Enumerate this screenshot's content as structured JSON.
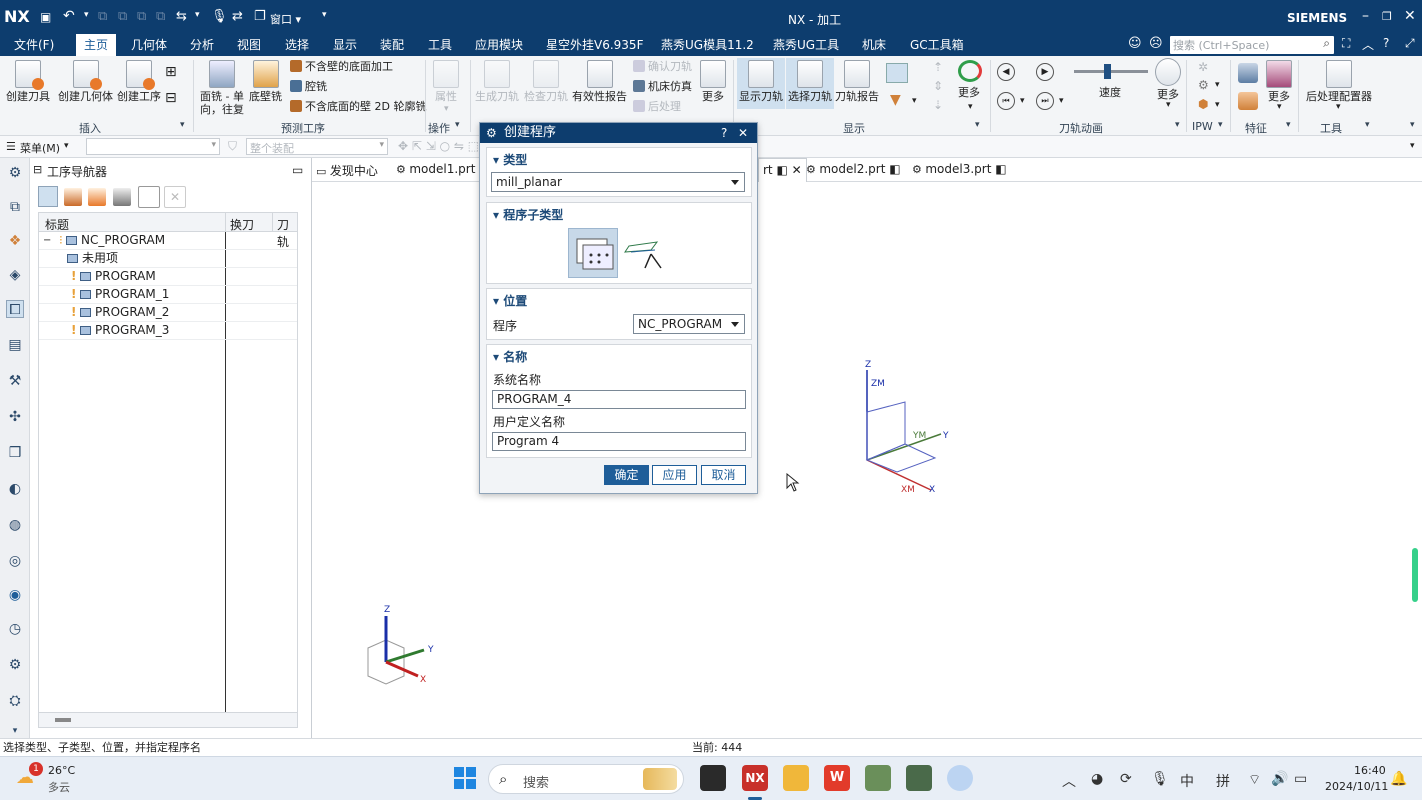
{
  "app": {
    "logo": "NX",
    "title": "NX - 加工",
    "brand": "SIEMENS"
  },
  "menubar": {
    "items": [
      "文件(F)",
      "主页",
      "几何体",
      "分析",
      "视图",
      "选择",
      "显示",
      "装配",
      "工具",
      "应用模块",
      "星空外挂V6.935F",
      "燕秀UG模具11.2",
      "燕秀UG工具",
      "机床",
      "GC工具箱"
    ],
    "search_placeholder": "搜索 (Ctrl+Space)"
  },
  "ribbon": {
    "insert": [
      "创建刀具",
      "创建几何体",
      "创建工序"
    ],
    "insert_group": "插入",
    "predef": {
      "face_mill_1": "面铣 - 单",
      "face_mill_2": "向，往复",
      "floor_wall": "底壁铣",
      "items": [
        "不含壁的底面加工",
        "腔铣",
        "不含底面的壁 2D 轮廓铣"
      ]
    },
    "predef_group": "预测工序",
    "op": {
      "label": "属性",
      "group": "操作"
    },
    "gen": [
      "生成刀轨",
      "检查刀轨",
      "有效性报告"
    ],
    "confirm": [
      "确认刀轨",
      "机床仿真",
      "后处理"
    ],
    "more": "更多",
    "display": [
      "显示刀轨",
      "选择刀轨",
      "刀轨报告"
    ],
    "display_group": "显示",
    "animation": {
      "speed": "速度",
      "group": "刀轨动画",
      "speed_level": 0.45
    },
    "ipw": "IPW",
    "feature": "特征",
    "post": "后处理配置器",
    "tools_group": "工具"
  },
  "toolbar2": {
    "menu": "菜单(M)",
    "filter_value": "",
    "assembly": "整个装配"
  },
  "navigator": {
    "title": "工序导航器",
    "columns": [
      "标题",
      "换刀",
      "刀轨"
    ],
    "rows": [
      {
        "name": "NC_PROGRAM",
        "level": 0
      },
      {
        "name": "未用项",
        "level": 1
      },
      {
        "name": "PROGRAM",
        "level": 1,
        "warn": true
      },
      {
        "name": "PROGRAM_1",
        "level": 1,
        "warn": true
      },
      {
        "name": "PROGRAM_2",
        "level": 1,
        "warn": true
      },
      {
        "name": "PROGRAM_3",
        "level": 1,
        "warn": true
      }
    ]
  },
  "tabs": [
    "发现中心",
    "model1.prt",
    "rt",
    "model2.prt",
    "model3.prt"
  ],
  "dialog": {
    "title": "创建程序",
    "type_label": "类型",
    "type_value": "mill_planar",
    "subtype_label": "程序子类型",
    "location_label": "位置",
    "program_label": "程序",
    "program_value": "NC_PROGRAM",
    "name_label": "名称",
    "system_name_label": "系统名称",
    "system_name_value": "PROGRAM_4",
    "user_name_label": "用户定义名称",
    "user_name_value": "Program 4",
    "ok": "确定",
    "apply": "应用",
    "cancel": "取消"
  },
  "axes": {
    "z": "Z",
    "zm": "ZM",
    "ym": "YM",
    "y": "Y",
    "xm": "XM",
    "x": "X"
  },
  "triad": {
    "z": "Z",
    "y": "Y",
    "x": "X"
  },
  "status": {
    "prompt": "选择类型、子类型、位置，并指定程序名",
    "current": "当前: 444"
  },
  "taskbar": {
    "weather_temp": "26°C",
    "weather_desc": "多云",
    "weather_badge": "1",
    "search": "搜索",
    "ime1": "中",
    "ime2": "拼",
    "time": "16:40",
    "date": "2024/10/11"
  },
  "colors": {
    "title_bg": "#0d3d6e",
    "accent": "#1f5e99",
    "warn": "#e8a13a"
  }
}
